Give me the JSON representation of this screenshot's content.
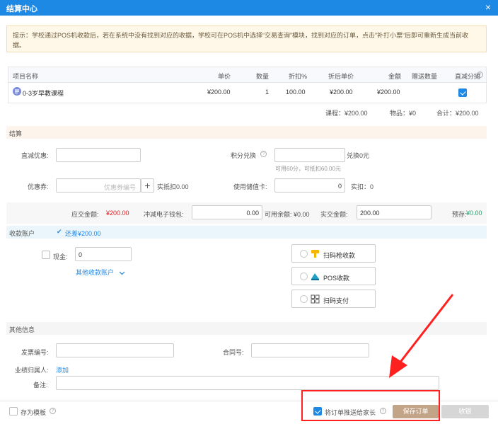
{
  "window": {
    "title": "结算中心"
  },
  "tip": {
    "text": "提示：学校通过POS机收款后，若在系统中没有找到对应的收据，学校可在POS机中选择“交易查询”模块，找到对应的订单，点击”补打小票“后即可重新生成当前收据。"
  },
  "table": {
    "headers": [
      "项目名称",
      "单价",
      "数量",
      "折扣%",
      "折后单价",
      "金额",
      "赠送数量",
      "直减分摊"
    ],
    "rows": [
      {
        "name": "0-3岁早教课程",
        "price": "¥200.00",
        "qty": "1",
        "discount": "100.00",
        "discounted_price": "¥200.00",
        "amount": "¥200.00",
        "gift_qty": "",
        "checked": true
      }
    ]
  },
  "totals": {
    "course": "课程：¥200.00",
    "goods": "物品：¥0",
    "total": "合计：¥200.00"
  },
  "settle": {
    "section_title": "结算",
    "direct_discount_label": "直减优惠:",
    "points_label": "积分兑换",
    "points_suffix": "兑换0元",
    "points_hint": "可用60分，可抵扣60.00元",
    "coupon_label": "优惠券:",
    "coupon_placeholder": "优惠券编号",
    "coupon_add": "+",
    "coupon_deduct": "实抵扣0.00",
    "stored_card_label": "使用储值卡:",
    "stored_card_value": "0",
    "stored_card_deduct": "实扣：0"
  },
  "payment": {
    "due_label": "应交金额:",
    "due_value": "¥200.00",
    "wallet_label": "冲减电子钱包:",
    "wallet_value": "0.00",
    "balance_label": "可用余额: ¥0.00",
    "actual_label": "实交金额:",
    "actual_value": "200.00",
    "prepaid_label": "预存:",
    "prepaid_value": "¥0.00"
  },
  "account": {
    "section_title": "收款账户",
    "remaining": "还差¥200.00",
    "cash_label": "现金:",
    "cash_value": "0",
    "other_accounts": "其他收款账户",
    "methods": [
      {
        "label": "扫码枪收款",
        "icon": "scanner-gun-icon"
      },
      {
        "label": "POS收款",
        "icon": "pos-icon"
      },
      {
        "label": "扫码支付",
        "icon": "qr-code-icon"
      }
    ]
  },
  "other": {
    "section_title": "其他信息",
    "invoice_label": "发票编号:",
    "contract_label": "合同号:",
    "performance_label": "业绩归属人:",
    "performance_add": "添加",
    "remark_label": "备注:"
  },
  "footer": {
    "save_template": "存为模板",
    "push_parent": "将订单推送给家长",
    "save_order": "保存订单",
    "collect": "收银"
  },
  "colors": {
    "brand": "#1e88e5",
    "red": "#e02020",
    "green": "#22a06b",
    "save": "#c2a488",
    "arrow": "#ff2020"
  }
}
